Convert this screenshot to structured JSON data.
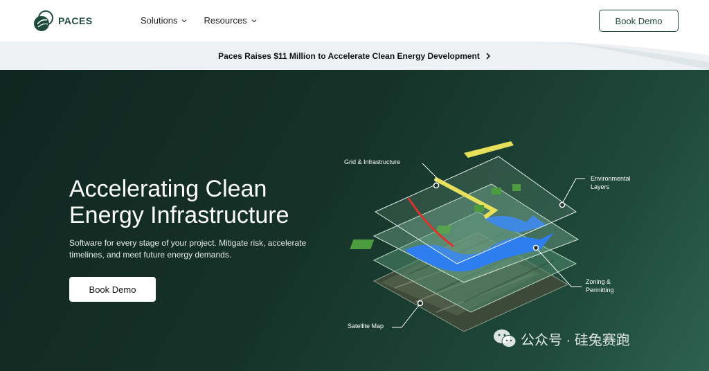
{
  "nav": {
    "logo_text": "PACES",
    "items": [
      {
        "label": "Solutions"
      },
      {
        "label": "Resources"
      }
    ],
    "cta": "Book Demo"
  },
  "announcement": {
    "text": "Paces Raises $11 Million to Accelerate Clean Energy Development"
  },
  "hero": {
    "title_line1": "Accelerating Clean",
    "title_line2": "Energy Infrastructure",
    "subtitle": "Software for every stage of your project. Mitigate risk, accelerate timelines, and meet future energy demands.",
    "cta": "Book Demo"
  },
  "illustration": {
    "layers": [
      {
        "label_line1": "Grid & Infrastructure",
        "label_line2": ""
      },
      {
        "label_line1": "Environmental",
        "label_line2": "Layers"
      },
      {
        "label_line1": "Zoning &",
        "label_line2": "Permitting"
      },
      {
        "label_line1": "Satellite Map",
        "label_line2": ""
      }
    ]
  },
  "watermark": {
    "text": "公众号 · 硅兔赛跑"
  },
  "colors": {
    "brand": "#1e4a3b",
    "hero_bg": "#163228",
    "announcement_bg": "#eef1f4"
  }
}
